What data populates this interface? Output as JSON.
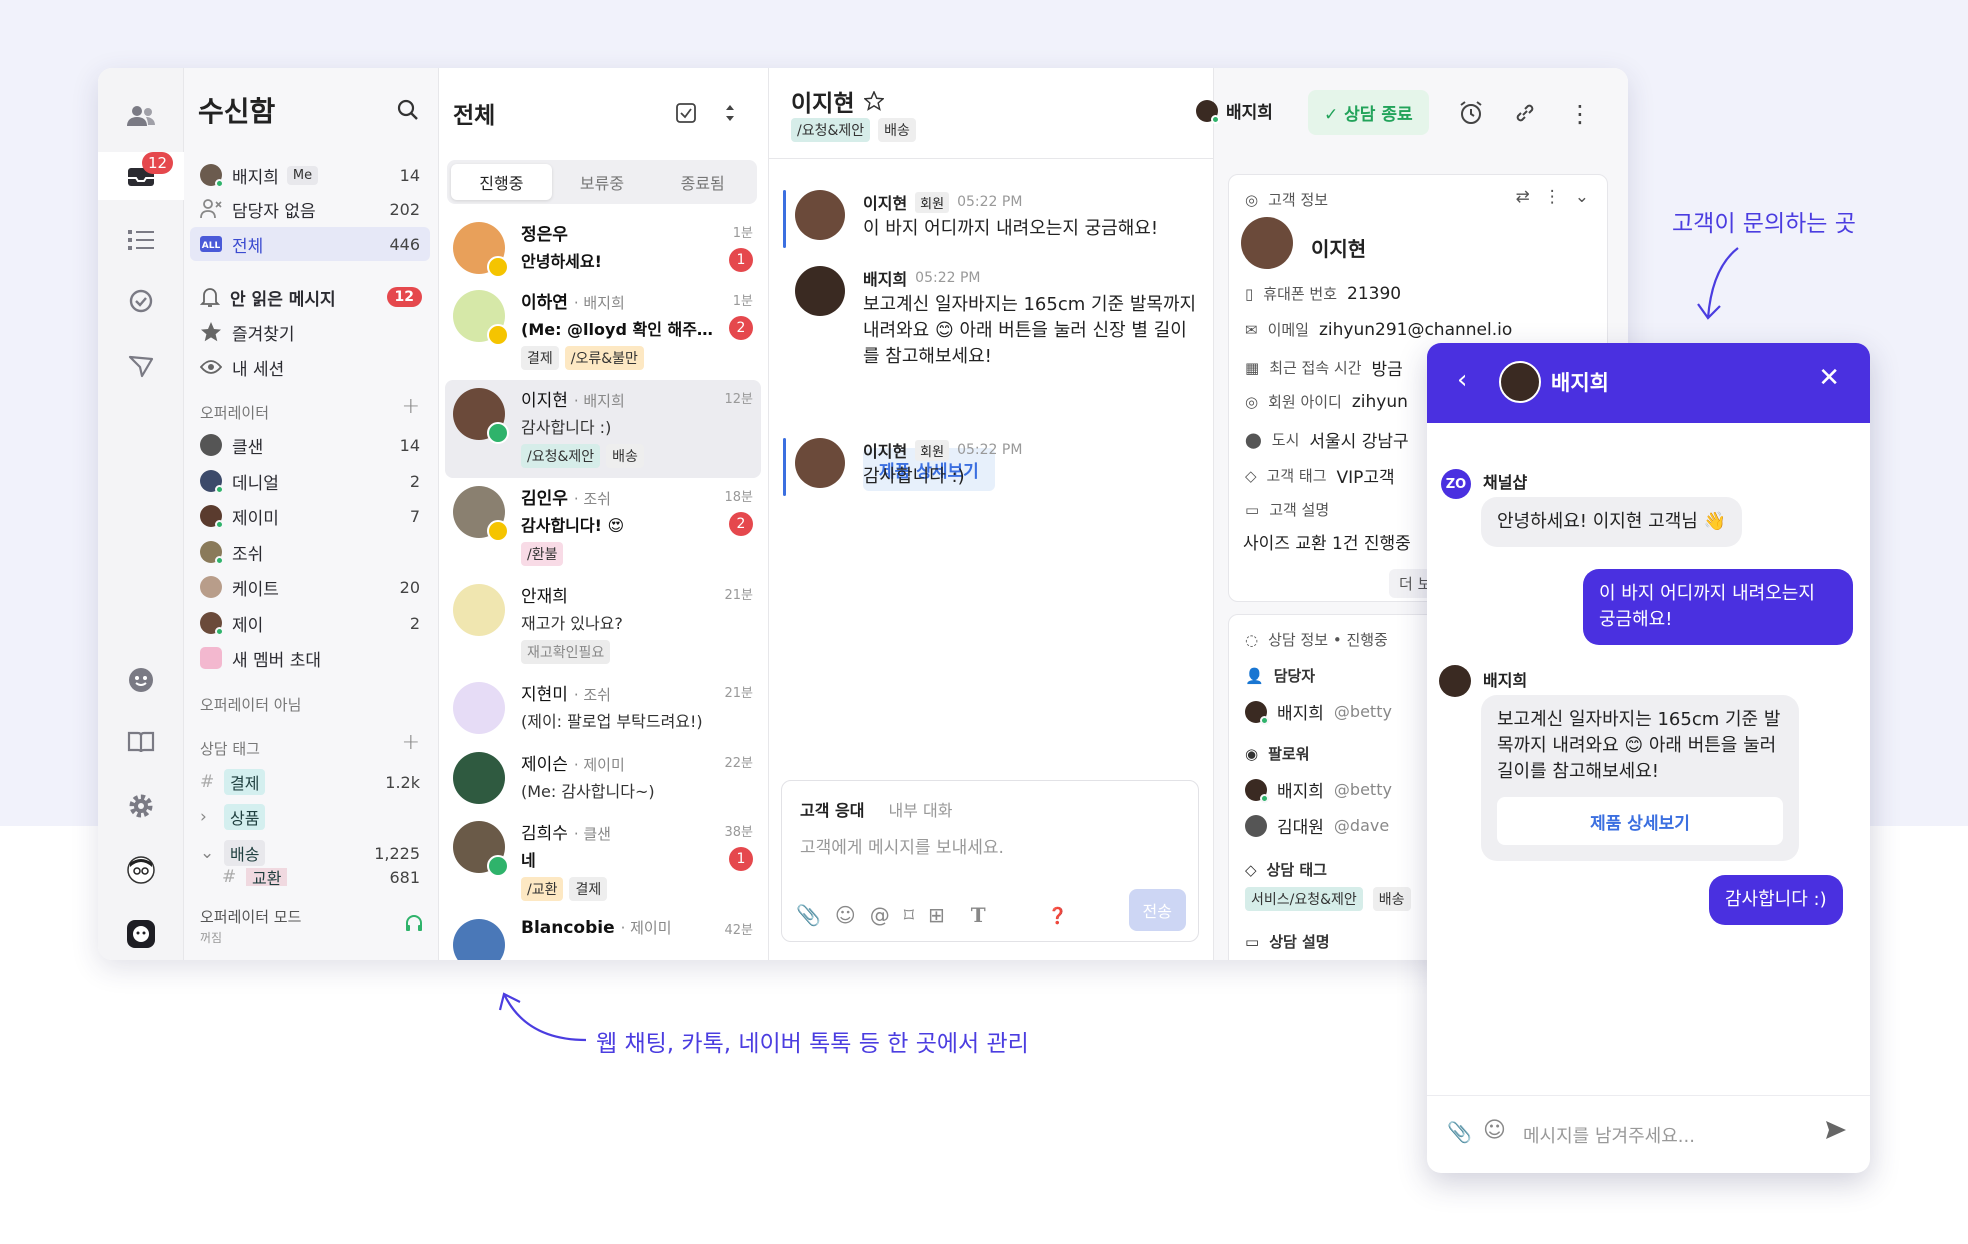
{
  "rail": {
    "inbox_badge": "12"
  },
  "inbox": {
    "title": "수신함",
    "items": [
      {
        "label": "배지희",
        "tag": "Me",
        "count": "14"
      },
      {
        "label": "담당자 없음",
        "count": "202"
      },
      {
        "label": "전체",
        "count": "446"
      },
      {
        "label": "안 읽은 메시지",
        "count": "12"
      },
      {
        "label": "즐겨찾기"
      },
      {
        "label": "내 세션"
      }
    ],
    "operators_title": "오퍼레이터",
    "operators": [
      {
        "name": "클샌",
        "count": "14"
      },
      {
        "name": "데니얼",
        "count": "2"
      },
      {
        "name": "제이미",
        "count": "7"
      },
      {
        "name": "조쉬",
        "count": ""
      },
      {
        "name": "케이트",
        "count": "20"
      },
      {
        "name": "제이",
        "count": "2"
      },
      {
        "name": "새 멤버 초대",
        "count": ""
      }
    ],
    "non_operator": "오퍼레이터 아님",
    "tags_title": "상담 태그",
    "tags": [
      {
        "name": "결제",
        "count": "1.2k"
      },
      {
        "name": "상품",
        "count": ""
      },
      {
        "name": "배송",
        "count": "1,225"
      },
      {
        "name": "교환",
        "count": "681"
      }
    ],
    "opmode": "오퍼레이터 모드",
    "opmode_sub": "꺼짐"
  },
  "list": {
    "title": "전체",
    "tabs": [
      "진행중",
      "보류중",
      "종료됨"
    ],
    "items": [
      {
        "name": "정은우",
        "op": "",
        "time": "1분",
        "preview": "안녕하세요!",
        "bold": true,
        "unread": "1",
        "tags": []
      },
      {
        "name": "이하연",
        "op": "· 배지희",
        "time": "1분",
        "preview": "(Me: @lloyd 확인 해주실...",
        "bold": true,
        "unread": "2",
        "tags": [
          "결제",
          "/오류&불만"
        ]
      },
      {
        "name": "이지현",
        "op": "· 배지희",
        "time": "12분",
        "preview": "감사합니다 :)",
        "bold": false,
        "unread": "",
        "tags": [
          "/요청&제안",
          "배송"
        ]
      },
      {
        "name": "김인우",
        "op": "· 조쉬",
        "time": "18분",
        "preview": "감사합니다! 😍",
        "bold": true,
        "unread": "2",
        "tags": [
          "/환불"
        ]
      },
      {
        "name": "안재희",
        "op": "",
        "time": "21분",
        "preview": "재고가 있나요?",
        "bold": false,
        "unread": "",
        "tags": [
          "재고확인필요"
        ]
      },
      {
        "name": "지현미",
        "op": "· 조쉬",
        "time": "21분",
        "preview": "(제이: 팔로업 부탁드려요!)",
        "bold": false,
        "unread": "",
        "tags": []
      },
      {
        "name": "제이슨",
        "op": "· 제이미",
        "time": "22분",
        "preview": "(Me: 감사합니다~)",
        "bold": false,
        "unread": "",
        "tags": []
      },
      {
        "name": "김희수",
        "op": "· 클샌",
        "time": "38분",
        "preview": "네",
        "bold": true,
        "unread": "1",
        "tags": [
          "/교환",
          "결제"
        ]
      },
      {
        "name": "Blancobie",
        "op": "· 제이미",
        "time": "42분",
        "preview": "",
        "bold": false,
        "unread": "",
        "tags": []
      }
    ]
  },
  "chat": {
    "name": "이지현",
    "tags": [
      "/요청&제안",
      "배송"
    ],
    "assignee": "배지희",
    "end_label": "상담 종료",
    "messages": [
      {
        "who": "이지현",
        "tag": "회원",
        "time": "05:22 PM",
        "text": "이 바지 어디까지 내려오는지 궁금해요!"
      },
      {
        "who": "배지희",
        "tag": "",
        "time": "05:22 PM",
        "text": "보고계신 일자바지는 165cm 기준 발목까지 내려와요 😊 아래 버튼을 눌러 신장 별 길이를 참고해보세요!"
      },
      {
        "who": "이지현",
        "tag": "회원",
        "time": "05:22 PM",
        "text": "감사합니다 :)"
      }
    ],
    "cta": "제품 상세보기",
    "composer": {
      "tab_on": "고객 응대",
      "tab_off": "내부 대화",
      "placeholder": "고객에게 메시지를 보내세요.",
      "send": "전송"
    }
  },
  "info": {
    "title": "고객 정보",
    "name": "이지현",
    "fields": [
      {
        "label": "휴대폰 번호",
        "value": "21390"
      },
      {
        "label": "이메일",
        "value": "zihyun291@channel.io"
      },
      {
        "label": "최근 접속 시간",
        "value": "방금"
      },
      {
        "label": "회원 아이디",
        "value": "zihyun"
      },
      {
        "label": "도시",
        "value": "서울시 강남구"
      },
      {
        "label": "고객 태그",
        "value": "VIP고객"
      },
      {
        "label": "고객 설명",
        "value": ""
      }
    ],
    "desc": "사이즈 교환 1건 진행중",
    "more": "더 보",
    "session_title": "상담 정보 • 진행중",
    "assignee_label": "담당자",
    "assignee": "배지희",
    "assignee_handle": "@betty",
    "follower_label": "팔로워",
    "followers": [
      {
        "name": "배지희",
        "handle": "@betty"
      },
      {
        "name": "김대원",
        "handle": "@dave"
      }
    ],
    "tag_label": "상담 태그",
    "tags": [
      "서비스/요청&제안",
      "배송"
    ],
    "desc_label": "상담 설명"
  },
  "widget": {
    "title": "배지희",
    "messages": [
      {
        "who": "채널샵",
        "text": "안녕하세요! 이지현 고객님 👋",
        "side": "in"
      },
      {
        "who": "",
        "text": "이 바지 어디까지 내려오는지 궁금해요!",
        "side": "out"
      },
      {
        "who": "배지희",
        "text": "보고계신 일자바지는 165cm 기준 발목까지 내려와요 😊 아래 버튼을 눌러 길이를 참고해보세요!",
        "side": "in"
      },
      {
        "who": "",
        "text": "감사합니다 :)",
        "side": "out"
      }
    ],
    "cta": "제품 상세보기",
    "placeholder": "메시지를 남겨주세요..."
  },
  "annotations": {
    "top": "고객이 문의하는 곳",
    "bottom": "웹 채팅, 카톡, 네이버 톡톡 등 한 곳에서 관리"
  },
  "colors": {
    "brand": "#4a30e0",
    "accent": "#3b6fe0",
    "success": "#22a35a",
    "alert": "#e5484d"
  }
}
